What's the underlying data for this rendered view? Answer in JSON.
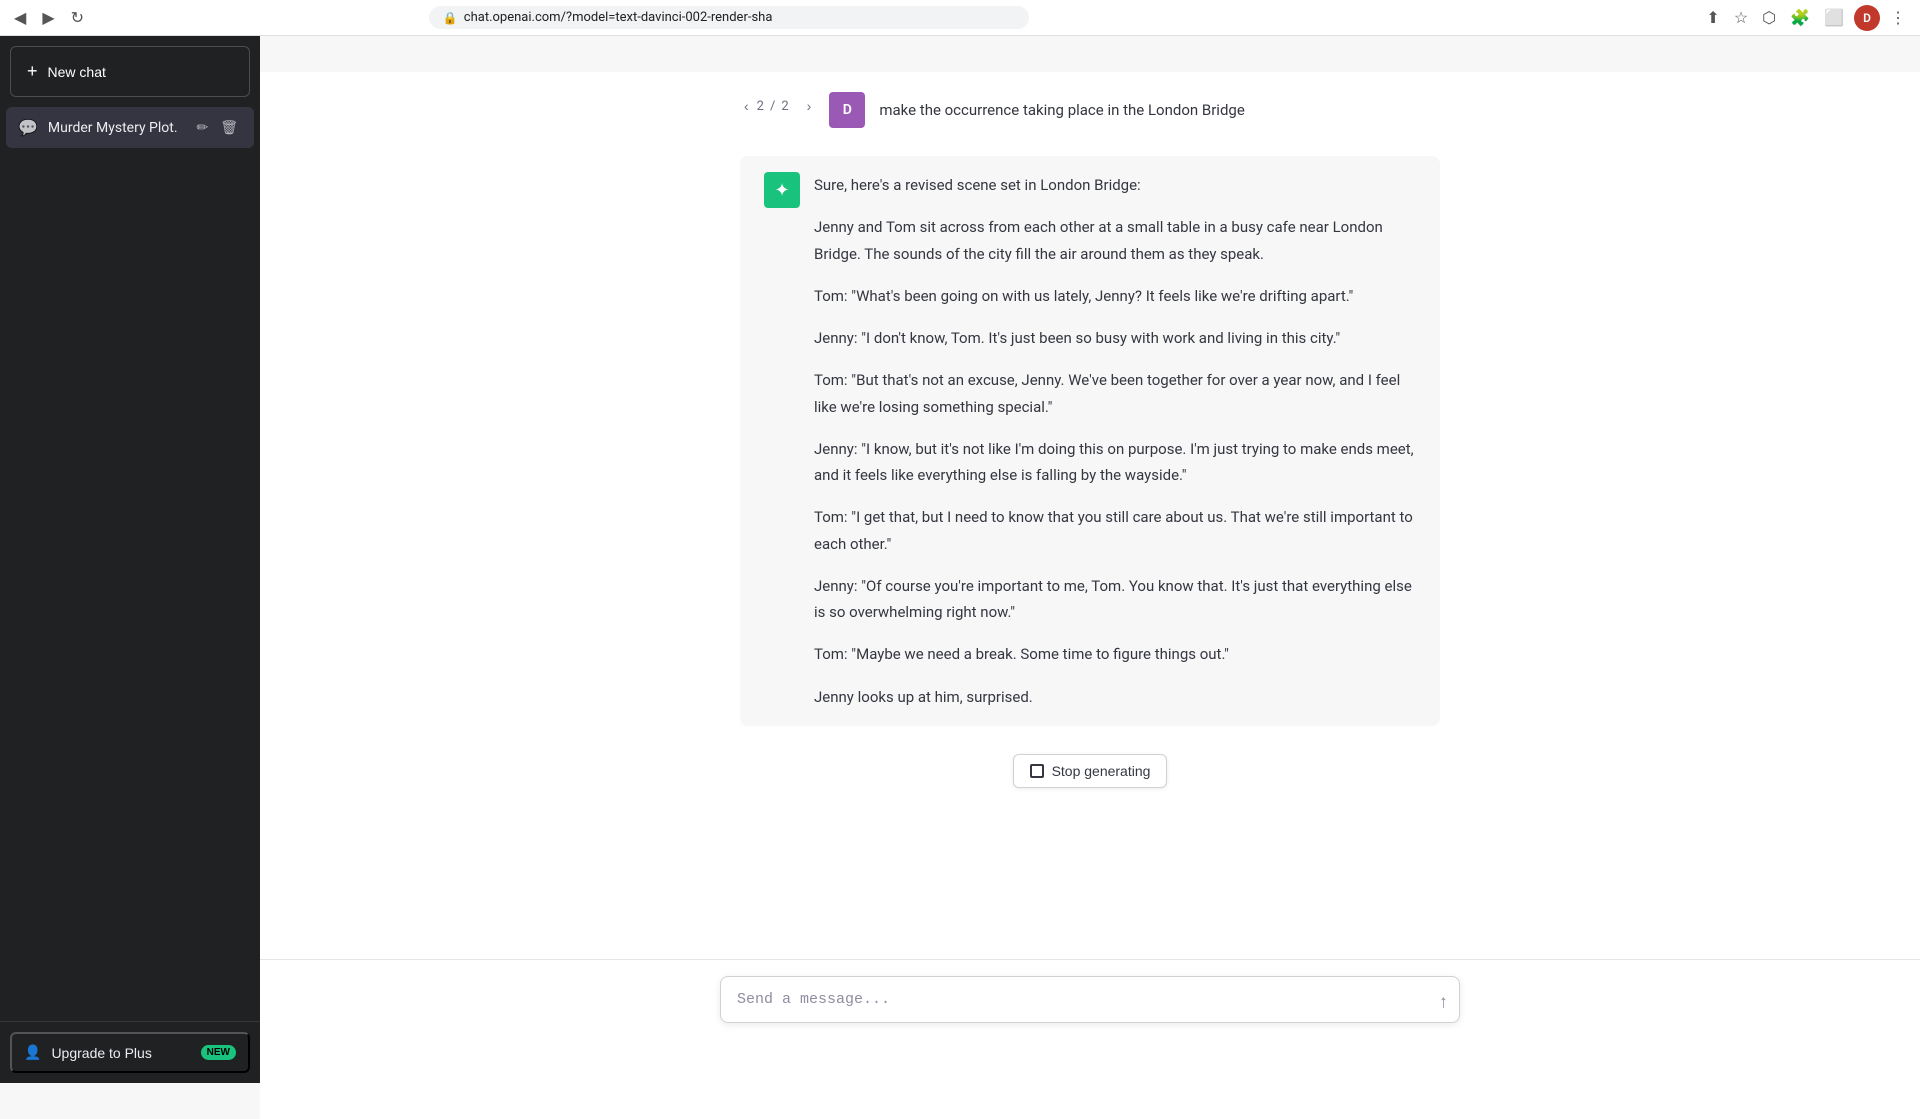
{
  "browser": {
    "url": "chat.openai.com/?model=text-davinci-002-render-sha",
    "back_label": "◀",
    "forward_label": "▶",
    "reload_label": "↻",
    "lock_icon": "🔒",
    "avatar_letter": "D",
    "avatar_color": "#c0392b"
  },
  "sidebar": {
    "new_chat_label": "New chat",
    "items": [
      {
        "label": "Murder Mystery Plot.",
        "icon": "💬",
        "active": true
      }
    ],
    "footer": {
      "upgrade_label": "Upgrade to Plus",
      "upgrade_icon": "👤",
      "new_badge": "NEW"
    }
  },
  "chat": {
    "pagination": {
      "current": 2,
      "total": 2,
      "prev_label": "‹",
      "next_label": "›"
    },
    "user_avatar_letter": "D",
    "user_message": "make the occurrence taking place in the London Bridge",
    "ai_intro": "Sure, here's a revised scene set in London Bridge:",
    "ai_paragraphs": [
      "Jenny and Tom sit across from each other at a small table in a busy cafe near London Bridge. The sounds of the city fill the air around them as they speak.",
      "Tom: \"What's been going on with us lately, Jenny? It feels like we're drifting apart.\"",
      "Jenny: \"I don't know, Tom. It's just been so busy with work and living in this city.\"",
      "Tom: \"But that's not an excuse, Jenny. We've been together for over a year now, and I feel like we're losing something special.\"",
      "Jenny: \"I know, but it's not like I'm doing this on purpose. I'm just trying to make ends meet, and it feels like everything else is falling by the wayside.\"",
      "Tom: \"I get that, but I need to know that you still care about us. That we're still important to each other.\"",
      "Jenny: \"Of course you're important to me, Tom. You know that. It's just that everything else is so overwhelming right now.\"",
      "Tom: \"Maybe we need a break. Some time to figure things out.\"",
      "Jenny looks up at him, surprised."
    ],
    "stop_generating_label": "Stop generating",
    "input_placeholder": "Send a message...",
    "send_icon": "↑",
    "scroll_down_icon": "↓"
  }
}
